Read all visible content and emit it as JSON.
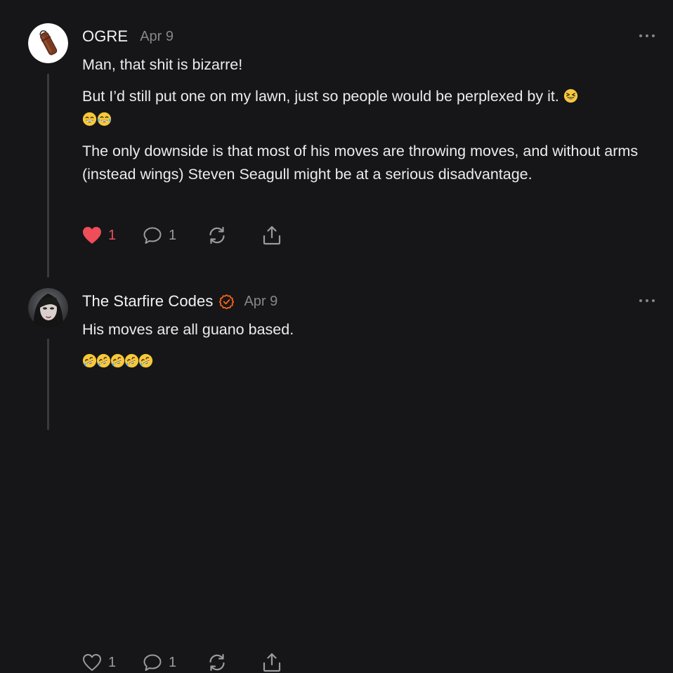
{
  "comments": [
    {
      "author": "OGRE",
      "date": "Apr 9",
      "avatar_icon": "leather-bag-avatar",
      "verified": false,
      "paragraphs": [
        "Man, that shit is bizarre!",
        "But I’d still put one on my lawn, just so people would be perplexed by it. ",
        "The only downside is that most of his moves are throwing moves, and without arms (instead wings) Steven Seagull might be at a serious disadvantage."
      ],
      "emojis": [
        "grinning-squinting-face",
        "beaming-face",
        "tears-of-joy-face"
      ],
      "likes": "1",
      "liked": true,
      "replies": "1"
    },
    {
      "author": "The Starfire Codes",
      "date": "Apr 9",
      "avatar_icon": "woman-portrait-avatar",
      "verified": true,
      "paragraphs": [
        "His moves are all guano based."
      ],
      "emojis": [
        "rolling-on-floor-laughing",
        "rolling-on-floor-laughing",
        "rolling-on-floor-laughing",
        "rolling-on-floor-laughing",
        "rolling-on-floor-laughing"
      ],
      "likes": "1",
      "liked": false,
      "replies": "1"
    }
  ],
  "colors": {
    "background": "#161618",
    "text": "#ececed",
    "muted": "#86868b",
    "like_red": "#ef4d5a",
    "verified_orange": "#ff6719"
  }
}
